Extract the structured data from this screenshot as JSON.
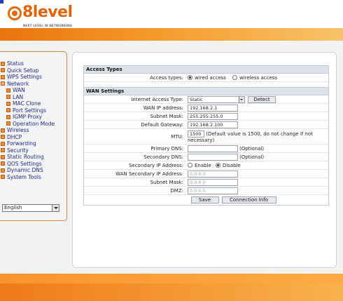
{
  "brand": {
    "name": "8level",
    "tagline": "NEXT LEVEL IN NETWORKING"
  },
  "colors": {
    "accent": "#e26c0c",
    "menu_link": "#1a2a8a",
    "section_head": "#dde1e8"
  },
  "sidebar": {
    "items": [
      {
        "label": "Status",
        "icon": "plus-box-icon",
        "level": 0
      },
      {
        "label": "Quick Setup",
        "icon": "plus-box-icon",
        "level": 0
      },
      {
        "label": "WPS Settings",
        "icon": "plus-box-icon",
        "level": 0
      },
      {
        "label": "Network",
        "icon": "minus-box-icon",
        "level": 0
      },
      {
        "label": "WAN",
        "icon": "page-box-icon",
        "level": 1
      },
      {
        "label": "LAN",
        "icon": "page-box-icon",
        "level": 1
      },
      {
        "label": "MAC Clone",
        "icon": "page-box-icon",
        "level": 1
      },
      {
        "label": "Port Settings",
        "icon": "page-box-icon",
        "level": 1
      },
      {
        "label": "IGMP Proxy",
        "icon": "page-box-icon",
        "level": 1
      },
      {
        "label": "Operation Mode",
        "icon": "page-box-icon",
        "level": 1
      },
      {
        "label": "Wireless",
        "icon": "plus-box-icon",
        "level": 0
      },
      {
        "label": "DHCP",
        "icon": "plus-box-icon",
        "level": 0
      },
      {
        "label": "Forwarding",
        "icon": "plus-box-icon",
        "level": 0
      },
      {
        "label": "Security",
        "icon": "plus-box-icon",
        "level": 0
      },
      {
        "label": "Static Routing",
        "icon": "plus-box-icon",
        "level": 0
      },
      {
        "label": "QOS Settings",
        "icon": "plus-box-icon",
        "level": 0
      },
      {
        "label": "Dynamic DNS",
        "icon": "plus-box-icon",
        "level": 0
      },
      {
        "label": "System Tools",
        "icon": "plus-box-icon",
        "level": 0
      }
    ],
    "language": {
      "selected": "English"
    }
  },
  "access_types": {
    "section_title": "Access Types",
    "label": "Access types:",
    "options": [
      "wired access",
      "wireless access"
    ],
    "selected": "wired access"
  },
  "wan": {
    "section_title": "WAN Settings",
    "internet_access_type_label": "Internet Access Type:",
    "internet_access_type_value": "Static",
    "detect_label": "Detect",
    "wan_ip_label": "WAN IP address:",
    "wan_ip_value": "192.168.2.1",
    "subnet_label": "Subnet Mask:",
    "subnet_value": "255.255.255.0",
    "gateway_label": "Default Gateway:",
    "gateway_value": "192.168.2.100",
    "mtu_label": "MTU:",
    "mtu_value": "1500",
    "mtu_note": "(Default value is 1500, do not change if not necessary)",
    "primary_dns_label": "Primary DNS:",
    "primary_dns_value": "",
    "primary_dns_hint": "(Optional)",
    "secondary_dns_label": "Secondary DNS:",
    "secondary_dns_value": "",
    "secondary_dns_hint": "(Optional)",
    "secondary_ip_label": "Secondary IP Address:",
    "secondary_ip_options": [
      "Enable",
      "Disable"
    ],
    "secondary_ip_selected": "Disable",
    "wan_secondary_ip_label": "WAN Secondary IP Address:",
    "wan_secondary_ip_value": "0.0.0.0",
    "secondary_subnet_label": "Subnet Mask:",
    "secondary_subnet_value": "0.0.0.0",
    "dmz_label": "DMZ:",
    "dmz_value": "0.0.0.0",
    "save_label": "Save",
    "connection_info_label": "Connection Info"
  }
}
